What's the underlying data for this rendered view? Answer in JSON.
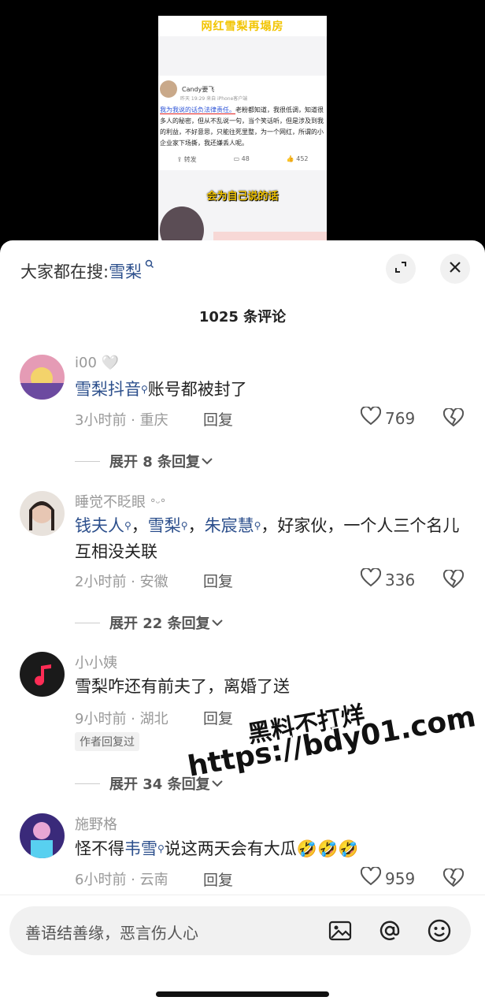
{
  "video": {
    "title": "网红雪梨再塌房",
    "post_user": "Candy要飞",
    "post_meta": "昨天 19:29  来自 iPhone客户端",
    "post_highlight": "我为我说的话负法律责任。",
    "post_body": "老粉都知道，我很低调，知道很多人的秘密，但从不乱说一句，当个笑话听，但是涉及到我的利益，不好意思，只能往死里整，为一个网红，所谓的小企业家下场撕，我还嫌丢人呢。",
    "repost_label": "转发",
    "comment_count": "48",
    "like_count": "452",
    "caption": "会为自己说的话"
  },
  "sheet": {
    "search_prefix": "大家都在搜:",
    "search_term": "雪梨",
    "comment_total": "1025 条评论"
  },
  "comments": [
    {
      "user": "i00",
      "mention": "雪梨抖音",
      "text": "账号都被封了",
      "meta": "3小时前 · 重庆",
      "reply": "回复",
      "likes": "769",
      "expand": "展开 8 条回复"
    },
    {
      "user": "睡觉不眨眼",
      "mention1": "钱夫人",
      "sep1": "，",
      "mention2": "雪梨",
      "sep2": "，",
      "mention3": "朱宸慧",
      "text": "，好家伙，一个人三个名儿互相没关联",
      "meta": "2小时前 · 安徽",
      "reply": "回复",
      "likes": "336",
      "expand": "展开 22 条回复"
    },
    {
      "user": "小小姨",
      "text": "雪梨咋还有前夫了，离婚了送",
      "meta": "9小时前 · 湖北",
      "reply": "回复",
      "tag": "作者回复过",
      "expand": "展开 34 条回复"
    },
    {
      "user": "施野格",
      "prefix": "怪不得",
      "mention": "韦雪",
      "text": "说这两天会有大瓜🤣🤣🤣",
      "meta": "6小时前 · 云南",
      "reply": "回复",
      "likes": "959"
    }
  ],
  "watermark": {
    "line1": "黑料不打烊",
    "line2": "https://bdy01.com"
  },
  "input": {
    "placeholder": "善语结善缘，恶言伤人心"
  },
  "icons": {
    "search_hint": "search-hint-icon",
    "expand": "expand-icon",
    "close": "close-icon",
    "heart": "heart-icon",
    "broken_heart": "broken-heart-icon",
    "chevron": "chevron-down-icon",
    "image": "image-icon",
    "at": "at-icon",
    "emoji": "emoji-icon"
  }
}
